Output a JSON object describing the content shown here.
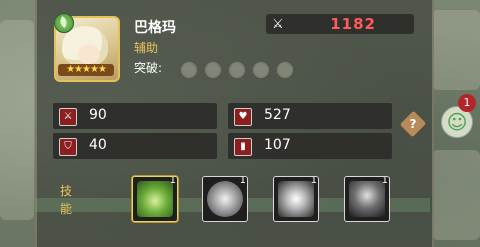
{
  "hero": {
    "name": "巴格玛",
    "role": "辅助",
    "breakthrough_label": "突破:",
    "breakthrough_total": 5,
    "breakthrough_filled": 0,
    "star_count": 5,
    "element": "leaf-element-icon"
  },
  "power": {
    "icon": "crossed-swords-icon",
    "value": "1182",
    "color": "#ff5a5a"
  },
  "stats": {
    "attack": {
      "icon": "sword-icon",
      "value": "90"
    },
    "hp": {
      "icon": "heart-icon",
      "value": "527"
    },
    "defense": {
      "icon": "shield-icon",
      "value": "40"
    },
    "speed": {
      "icon": "speed-icon",
      "value": "107"
    }
  },
  "side": {
    "help_label": "?",
    "chat_badge": "1"
  },
  "skills": {
    "label": "技能",
    "items": [
      {
        "level": "1",
        "icon": "leaf-blade-skill-icon"
      },
      {
        "level": "1",
        "icon": "silver-orb-skill-icon"
      },
      {
        "level": "1",
        "icon": "white-burst-skill-icon"
      },
      {
        "level": "1",
        "icon": "dark-tree-skill-icon"
      }
    ]
  },
  "colors": {
    "accent": "#e8c45a",
    "panel": "#2f302c"
  }
}
